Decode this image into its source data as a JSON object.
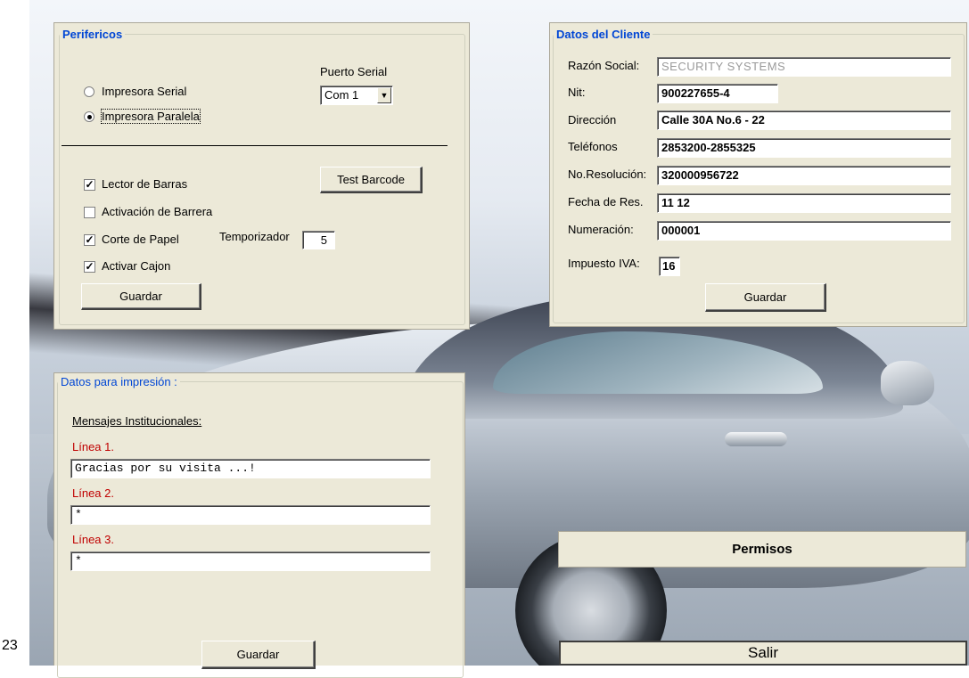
{
  "page_number": "23",
  "perifericos": {
    "legend": "Perifericos",
    "puerto_serial_label": "Puerto Serial",
    "puerto_serial_value": "Com 1",
    "radio_serial": "Impresora Serial",
    "radio_paralela": "Impresora Paralela",
    "selected_printer": "paralela",
    "lector_barras": "Lector de Barras",
    "lector_barras_checked": true,
    "activacion_barrera": "Activación de Barrera",
    "activacion_barrera_checked": false,
    "corte_papel": "Corte de Papel",
    "corte_papel_checked": true,
    "activar_cajon": "Activar Cajon",
    "activar_cajon_checked": true,
    "temporizador_label": "Temporizador",
    "temporizador_value": "5",
    "test_barcode_button": "Test Barcode",
    "guardar_button": "Guardar"
  },
  "cliente": {
    "legend": "Datos del Cliente",
    "fields": [
      {
        "label": "Razón Social:",
        "value": "SECURITY SYSTEMS"
      },
      {
        "label": "Nit:",
        "value": "900227655-4"
      },
      {
        "label": "Dirección",
        "value": "Calle 30A No.6 - 22"
      },
      {
        "label": "Teléfonos",
        "value": "2853200-2855325"
      },
      {
        "label": "No.Resolución:",
        "value": "320000956722"
      },
      {
        "label": "Fecha de Res.",
        "value": "11 12"
      },
      {
        "label": "Numeración:",
        "value": "000001"
      },
      {
        "label": "Impuesto IVA:",
        "value": "16"
      }
    ],
    "guardar_button": "Guardar"
  },
  "impresion": {
    "legend": "Datos para impresión :",
    "mensajes_label": "Mensajes Institucionales:",
    "lines": [
      {
        "label": "Línea 1.",
        "value": "Gracias por su visita ...!"
      },
      {
        "label": "Línea 2.",
        "value": "*"
      },
      {
        "label": "Línea 3.",
        "value": "*"
      }
    ],
    "guardar_button": "Guardar"
  },
  "permisos_button": "Permisos",
  "salir_button": "Salir",
  "colors": {
    "panel_bg": "#ece9d8",
    "legend_blue": "#0046d5",
    "line_label_red": "#c00000"
  }
}
